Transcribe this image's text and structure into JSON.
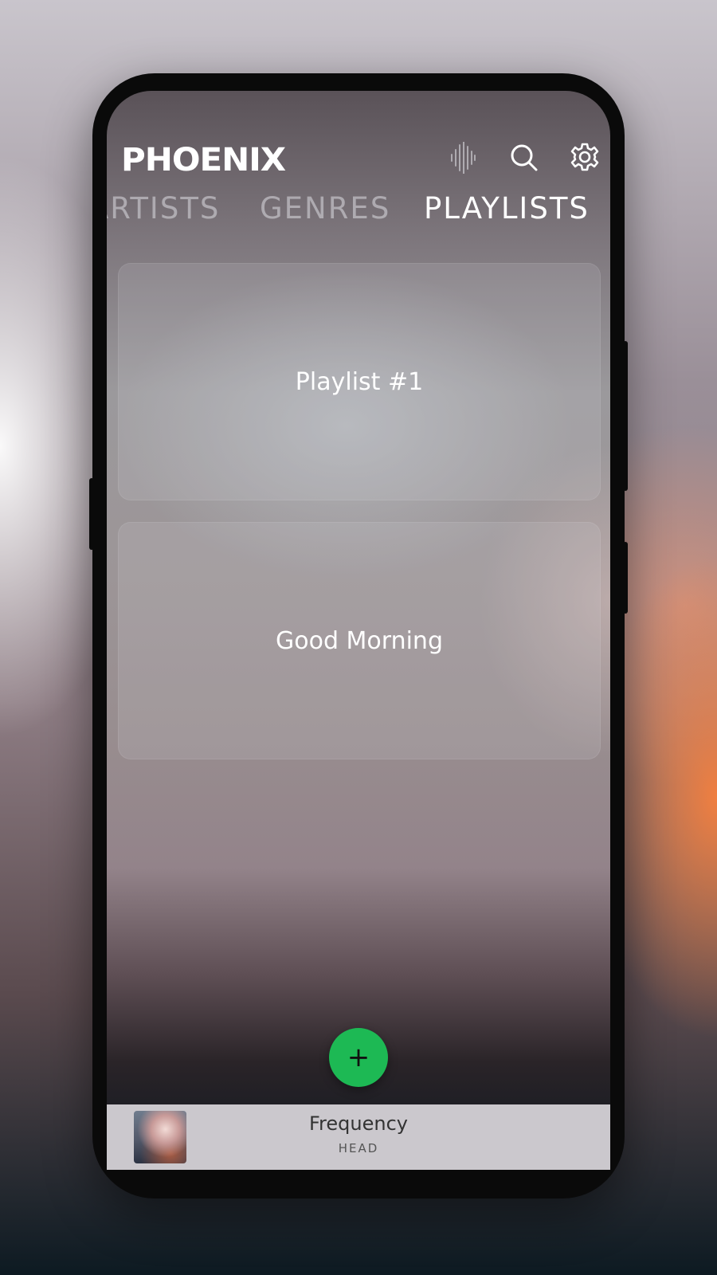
{
  "app": {
    "logo": "PHOENIX"
  },
  "header": {
    "icons": [
      "equalizer-icon",
      "search-icon",
      "gear-icon"
    ]
  },
  "tabs": [
    {
      "label": "ARTISTS",
      "active": false
    },
    {
      "label": "GENRES",
      "active": false
    },
    {
      "label": "PLAYLISTS",
      "active": true
    }
  ],
  "playlists": [
    {
      "title": "Playlist #1"
    },
    {
      "title": "Good Morning"
    }
  ],
  "fab": {
    "icon": "plus-icon",
    "glyph": "+"
  },
  "now_playing": {
    "title": "Frequency",
    "artist": "HEAD"
  },
  "colors": {
    "accent": "#1db954",
    "miniplayer_bg": "#cbc8cd"
  }
}
